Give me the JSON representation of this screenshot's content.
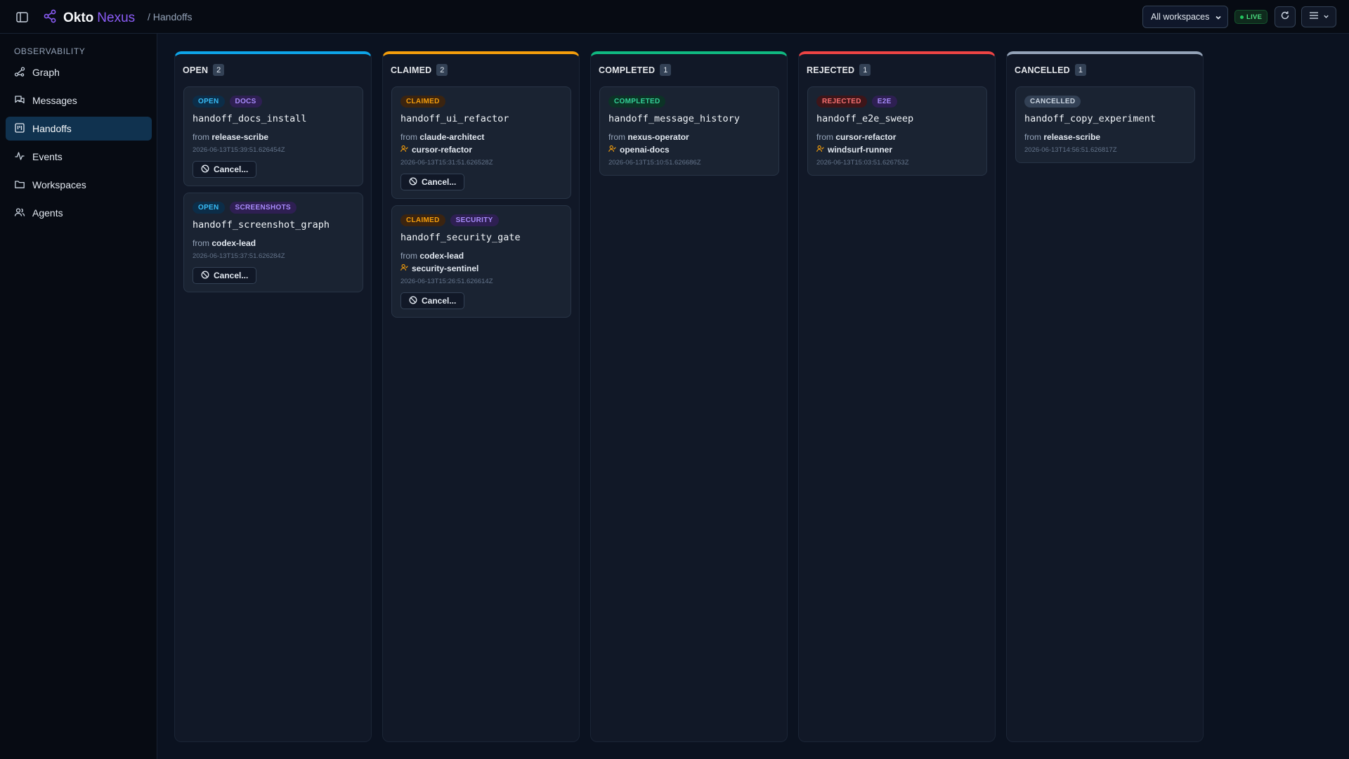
{
  "header": {
    "brand_primary": "Okto",
    "brand_accent": "Nexus",
    "breadcrumb": "/ Handoffs",
    "workspace_select": "All workspaces",
    "live_label": "LIVE"
  },
  "sidebar": {
    "section": "OBSERVABILITY",
    "items": [
      {
        "label": "Graph",
        "icon": "graph-icon"
      },
      {
        "label": "Messages",
        "icon": "messages-icon"
      },
      {
        "label": "Handoffs",
        "icon": "handoffs-icon",
        "active": true
      },
      {
        "label": "Events",
        "icon": "activity-icon"
      },
      {
        "label": "Workspaces",
        "icon": "folder-icon"
      },
      {
        "label": "Agents",
        "icon": "users-icon"
      }
    ]
  },
  "board": {
    "from_prefix": "from",
    "cancel_label": "Cancel...",
    "columns": [
      {
        "title": "OPEN",
        "count": "2",
        "color": "#0ea5e9",
        "cards": [
          {
            "status": "OPEN",
            "tag": "DOCS",
            "title": "handoff_docs_install",
            "from": "release-scribe",
            "claimer": null,
            "time": "2026-06-13T15:39:51.626454Z",
            "cancel": true
          },
          {
            "status": "OPEN",
            "tag": "SCREENSHOTS",
            "title": "handoff_screenshot_graph",
            "from": "codex-lead",
            "claimer": null,
            "time": "2026-06-13T15:37:51.626284Z",
            "cancel": true
          }
        ]
      },
      {
        "title": "CLAIMED",
        "count": "2",
        "color": "#f59e0b",
        "cards": [
          {
            "status": "CLAIMED",
            "tag": null,
            "title": "handoff_ui_refactor",
            "from": "claude-architect",
            "claimer": "cursor-refactor",
            "time": "2026-06-13T15:31:51.626528Z",
            "cancel": true
          },
          {
            "status": "CLAIMED",
            "tag": "SECURITY",
            "title": "handoff_security_gate",
            "from": "codex-lead",
            "claimer": "security-sentinel",
            "time": "2026-06-13T15:26:51.626614Z",
            "cancel": true
          }
        ]
      },
      {
        "title": "COMPLETED",
        "count": "1",
        "color": "#10b981",
        "cards": [
          {
            "status": "COMPLETED",
            "tag": null,
            "title": "handoff_message_history",
            "from": "nexus-operator",
            "claimer": "openai-docs",
            "time": "2026-06-13T15:10:51.626686Z",
            "cancel": false
          }
        ]
      },
      {
        "title": "REJECTED",
        "count": "1",
        "color": "#ef4444",
        "cards": [
          {
            "status": "REJECTED",
            "tag": "E2E",
            "title": "handoff_e2e_sweep",
            "from": "cursor-refactor",
            "claimer": "windsurf-runner",
            "time": "2026-06-13T15:03:51.626753Z",
            "cancel": false
          }
        ]
      },
      {
        "title": "CANCELLED",
        "count": "1",
        "color": "#94a3b8",
        "cards": [
          {
            "status": "CANCELLED",
            "tag": null,
            "title": "handoff_copy_experiment",
            "from": "release-scribe",
            "claimer": null,
            "time": "2026-06-13T14:56:51.626817Z",
            "cancel": false
          }
        ]
      }
    ]
  }
}
